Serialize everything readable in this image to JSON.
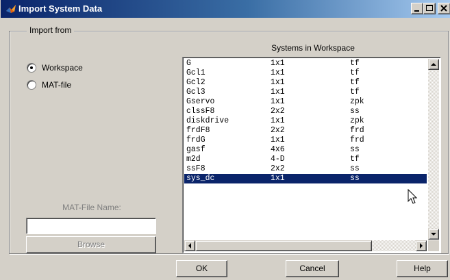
{
  "window": {
    "title": "Import System Data",
    "icon": "matlab-logo-icon",
    "controls": [
      "minimize-icon",
      "maximize-icon",
      "close-icon"
    ]
  },
  "import_from": {
    "legend": "Import from",
    "options": [
      {
        "label": "Workspace",
        "selected": true
      },
      {
        "label": "MAT-file",
        "selected": false
      }
    ],
    "mat_file_label": "MAT-File Name:",
    "mat_file_value": "",
    "browse_label": "Browse"
  },
  "workspace": {
    "title": "Systems in Workspace",
    "rows": [
      {
        "name": "G",
        "size": "1x1",
        "type": "tf"
      },
      {
        "name": "Gcl1",
        "size": "1x1",
        "type": "tf"
      },
      {
        "name": "Gcl2",
        "size": "1x1",
        "type": "tf"
      },
      {
        "name": "Gcl3",
        "size": "1x1",
        "type": "tf"
      },
      {
        "name": "Gservo",
        "size": "1x1",
        "type": "zpk"
      },
      {
        "name": "clssF8",
        "size": "2x2",
        "type": "ss"
      },
      {
        "name": "diskdrive",
        "size": "1x1",
        "type": "zpk"
      },
      {
        "name": "frdF8",
        "size": "2x2",
        "type": "frd"
      },
      {
        "name": "frdG",
        "size": "1x1",
        "type": "frd"
      },
      {
        "name": "gasf",
        "size": "4x6",
        "type": "ss"
      },
      {
        "name": "m2d",
        "size": "4-D",
        "type": "tf"
      },
      {
        "name": "ssF8",
        "size": "2x2",
        "type": "ss"
      },
      {
        "name": "sys_dc",
        "size": "1x1",
        "type": "ss"
      }
    ],
    "selected_index": 12
  },
  "buttons": {
    "ok": "OK",
    "cancel": "Cancel",
    "help": "Help"
  },
  "colors": {
    "titlebar_start": "#0a246a",
    "titlebar_end": "#a6caf0",
    "selection": "#0a246a",
    "face": "#d4d0c8"
  }
}
